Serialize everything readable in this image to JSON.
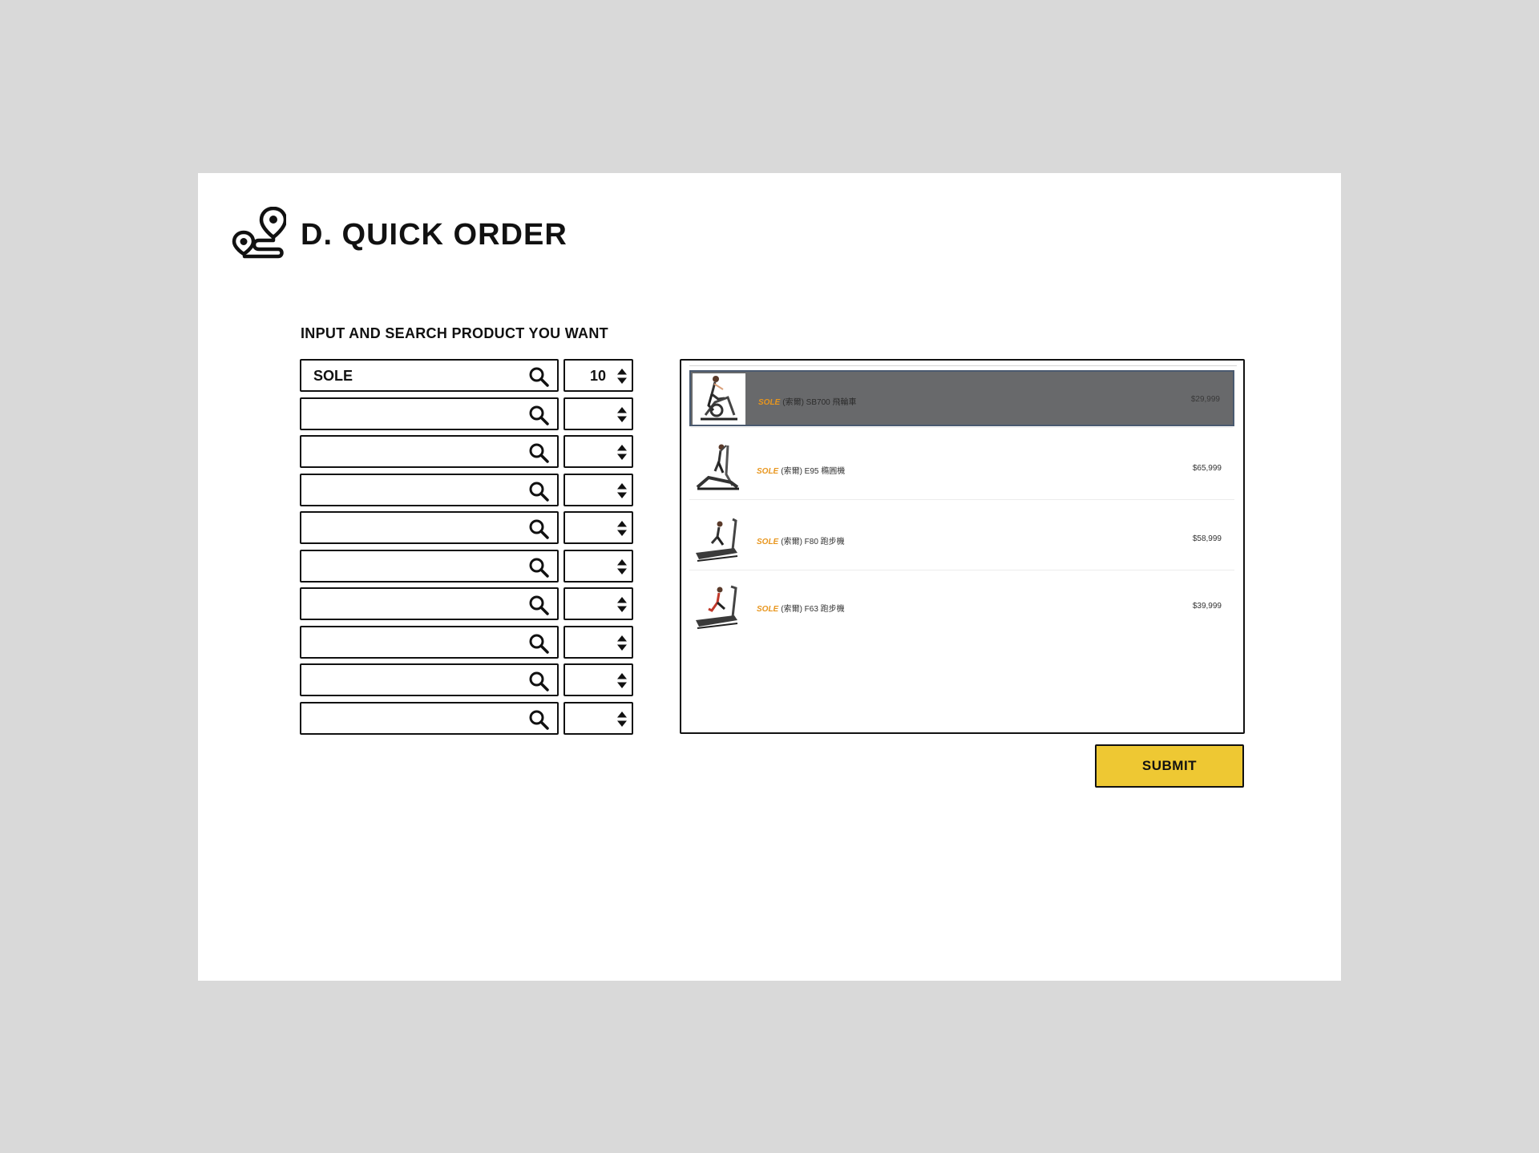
{
  "header": {
    "title": "D. QUICK ORDER",
    "logo_icon": "route-pin-icon"
  },
  "form": {
    "section_title": "INPUT AND SEARCH PRODUCT YOU WANT",
    "rows": [
      {
        "search": "SOLE",
        "qty": "10"
      },
      {
        "search": "",
        "qty": ""
      },
      {
        "search": "",
        "qty": ""
      },
      {
        "search": "",
        "qty": ""
      },
      {
        "search": "",
        "qty": ""
      },
      {
        "search": "",
        "qty": ""
      },
      {
        "search": "",
        "qty": ""
      },
      {
        "search": "",
        "qty": ""
      },
      {
        "search": "",
        "qty": ""
      },
      {
        "search": "",
        "qty": ""
      }
    ]
  },
  "results": [
    {
      "brand": "SOLE",
      "name": "(索爾) SB700 飛輪車",
      "price": "$29,999",
      "selected": true,
      "thumb_icon": "spin-bike-icon"
    },
    {
      "brand": "SOLE",
      "name": "(索爾) E95 橢圓機",
      "price": "$65,999",
      "selected": false,
      "thumb_icon": "elliptical-icon"
    },
    {
      "brand": "SOLE",
      "name": "(索爾) F80 跑步機",
      "price": "$58,999",
      "selected": false,
      "thumb_icon": "treadmill-icon"
    },
    {
      "brand": "SOLE",
      "name": "(索爾) F63 跑步機",
      "price": "$39,999",
      "selected": false,
      "thumb_icon": "treadmill-icon"
    }
  ],
  "actions": {
    "submit_label": "SUBMIT"
  },
  "colors": {
    "page_bg": "#d9d9d9",
    "accent": "#eec833",
    "brand": "#e8961e",
    "selected_row": "#68696b"
  }
}
